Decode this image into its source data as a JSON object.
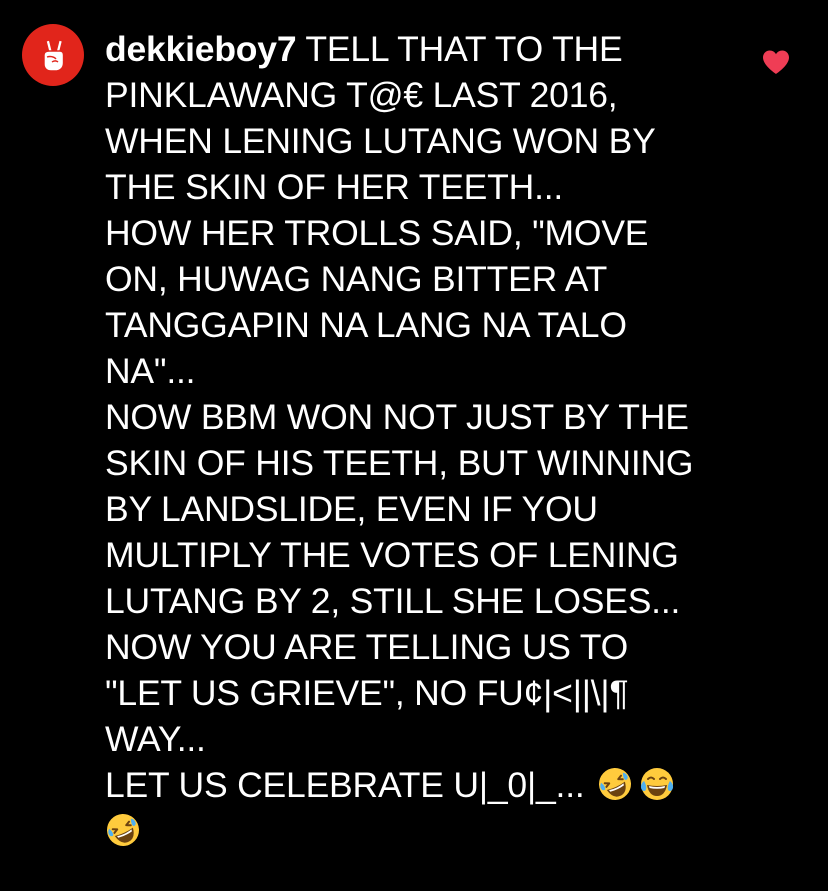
{
  "comment": {
    "username": "dekkieboy7",
    "lines": [
      " TELL THAT TO THE",
      "PINKLAWANG T@€ LAST 2016,",
      "WHEN LENING LUTANG WON BY",
      "THE SKIN OF HER TEETH...",
      "HOW HER TROLLS SAID, \"MOVE",
      "ON, HUWAG NANG BITTER AT",
      "TANGGAPIN NA LANG NA TALO",
      "NA\"...",
      "NOW BBM WON NOT JUST BY THE",
      "SKIN OF HIS TEETH, BUT WINNING",
      "BY LANDSLIDE, EVEN IF YOU",
      "MULTIPLY THE VOTES OF LENING",
      "LUTANG BY 2, STILL SHE LOSES...",
      "NOW YOU ARE TELLING US TO",
      "\"LET US GRIEVE\", NO FU¢|<||\\|¶",
      "WAY...",
      "LET US CELEBRATE U|_0|_..."
    ],
    "emojis": [
      "rolling-on-floor-laughing",
      "face-with-tears-of-joy",
      "rolling-on-floor-laughing"
    ]
  },
  "colors": {
    "background": "#000000",
    "text": "#ffffff",
    "avatar_bg": "#e1251b",
    "heart": "#ef3d55",
    "emoji_yellow": "#ffcb3d"
  },
  "icons": {
    "avatar": "victory-hand-icon",
    "like": "heart-icon"
  }
}
